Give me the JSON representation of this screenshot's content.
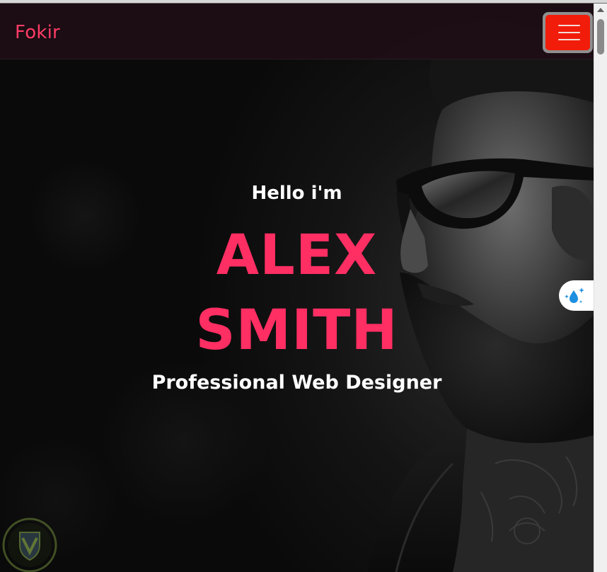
{
  "navbar": {
    "brand": "Fokir",
    "menu_icon": "hamburger-menu-icon",
    "menu_button_color": "#f21c0a"
  },
  "hero": {
    "greeting": "Hello i'm",
    "name_first": "ALEX",
    "name_last": "SMITH",
    "subtitle": "Professional Web Designer",
    "accent_color": "#ff2e63"
  },
  "extension_tab": {
    "icon": "water-drop-sparkle-icon"
  },
  "watermark": {
    "icon": "shield-logo-icon"
  }
}
